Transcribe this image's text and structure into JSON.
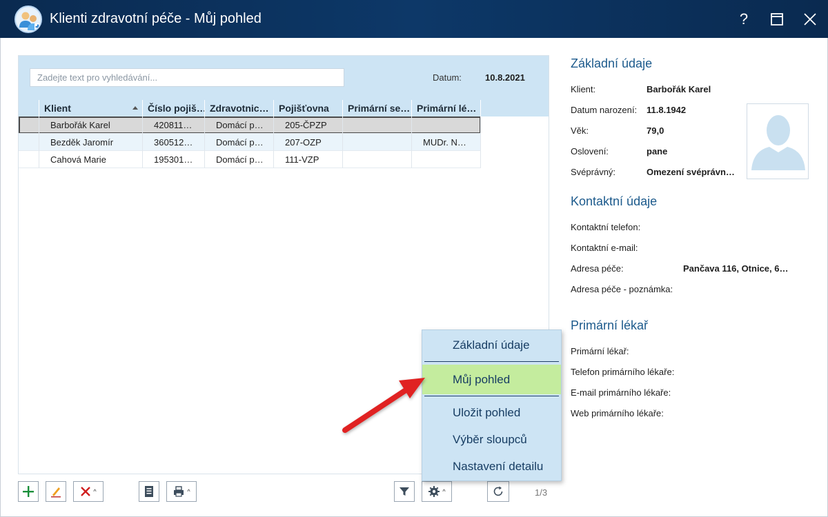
{
  "window": {
    "title": "Klienti zdravotní péče - Můj pohled",
    "help_label": "?",
    "close_label": "✕"
  },
  "search": {
    "placeholder": "Zadejte text pro vyhledávání..."
  },
  "date": {
    "label": "Datum:",
    "value": "10.8.2021"
  },
  "table": {
    "columns": [
      "Klient",
      "Číslo pojiš…",
      "Zdravotnic…",
      "Pojišťovna",
      "Primární se…",
      "Primární lé…"
    ],
    "sort_column": "Klient",
    "rows": [
      {
        "klient": "Barbořák Karel",
        "cislo": "420811…",
        "zdrav": "Domácí p…",
        "poj": "205-ČPZP",
        "prim_se": "",
        "prim_le": ""
      },
      {
        "klient": "Bezděk Jaromír",
        "cislo": "360512…",
        "zdrav": "Domácí p…",
        "poj": "207-OZP",
        "prim_se": "",
        "prim_le": "MUDr. N…"
      },
      {
        "klient": "Cahová Marie",
        "cislo": "195301…",
        "zdrav": "Domácí p…",
        "poj": "111-VZP",
        "prim_se": "",
        "prim_le": ""
      }
    ]
  },
  "toolbar": {
    "pager": "1/3",
    "icons": [
      "add-icon",
      "edit-icon",
      "delete-icon",
      "document-icon",
      "print-icon",
      "filter-icon",
      "gear-icon",
      "refresh-icon"
    ]
  },
  "menu": {
    "items": [
      "Základní údaje",
      "Můj pohled",
      "Uložit pohled",
      "Výběr sloupců",
      "Nastavení detailu"
    ],
    "highlighted": "Můj pohled"
  },
  "detail": {
    "basic": {
      "heading": "Základní údaje",
      "fields": [
        {
          "label": "Klient:",
          "value": "Barbořák Karel"
        },
        {
          "label": "Datum narození:",
          "value": "11.8.1942"
        },
        {
          "label": "Věk:",
          "value": "79,0"
        },
        {
          "label": "Oslovení:",
          "value": "pane"
        },
        {
          "label": "Svéprávný:",
          "value": "Omezení svéprávn…"
        }
      ]
    },
    "contact": {
      "heading": "Kontaktní údaje",
      "fields": [
        {
          "label": "Kontaktní telefon:",
          "value": ""
        },
        {
          "label": "Kontaktní e-mail:",
          "value": ""
        },
        {
          "label": "Adresa péče:",
          "value": "Pančava 116, Otnice, 6…"
        },
        {
          "label": "Adresa péče - poznámka:",
          "value": ""
        }
      ]
    },
    "doctor": {
      "heading": "Primární lékař",
      "fields": [
        {
          "label": "Primární lékař:",
          "value": ""
        },
        {
          "label": "Telefon primárního lékaře:",
          "value": ""
        },
        {
          "label": "E-mail primárního lékaře:",
          "value": ""
        },
        {
          "label": "Web primárního lékaře:",
          "value": ""
        }
      ]
    }
  },
  "colors": {
    "titlebar": "#0d3868",
    "grid_header": "#cde4f4",
    "menu_highlight": "#c4ec9e",
    "heading": "#1c5a8c",
    "arrow": "#e02020"
  }
}
